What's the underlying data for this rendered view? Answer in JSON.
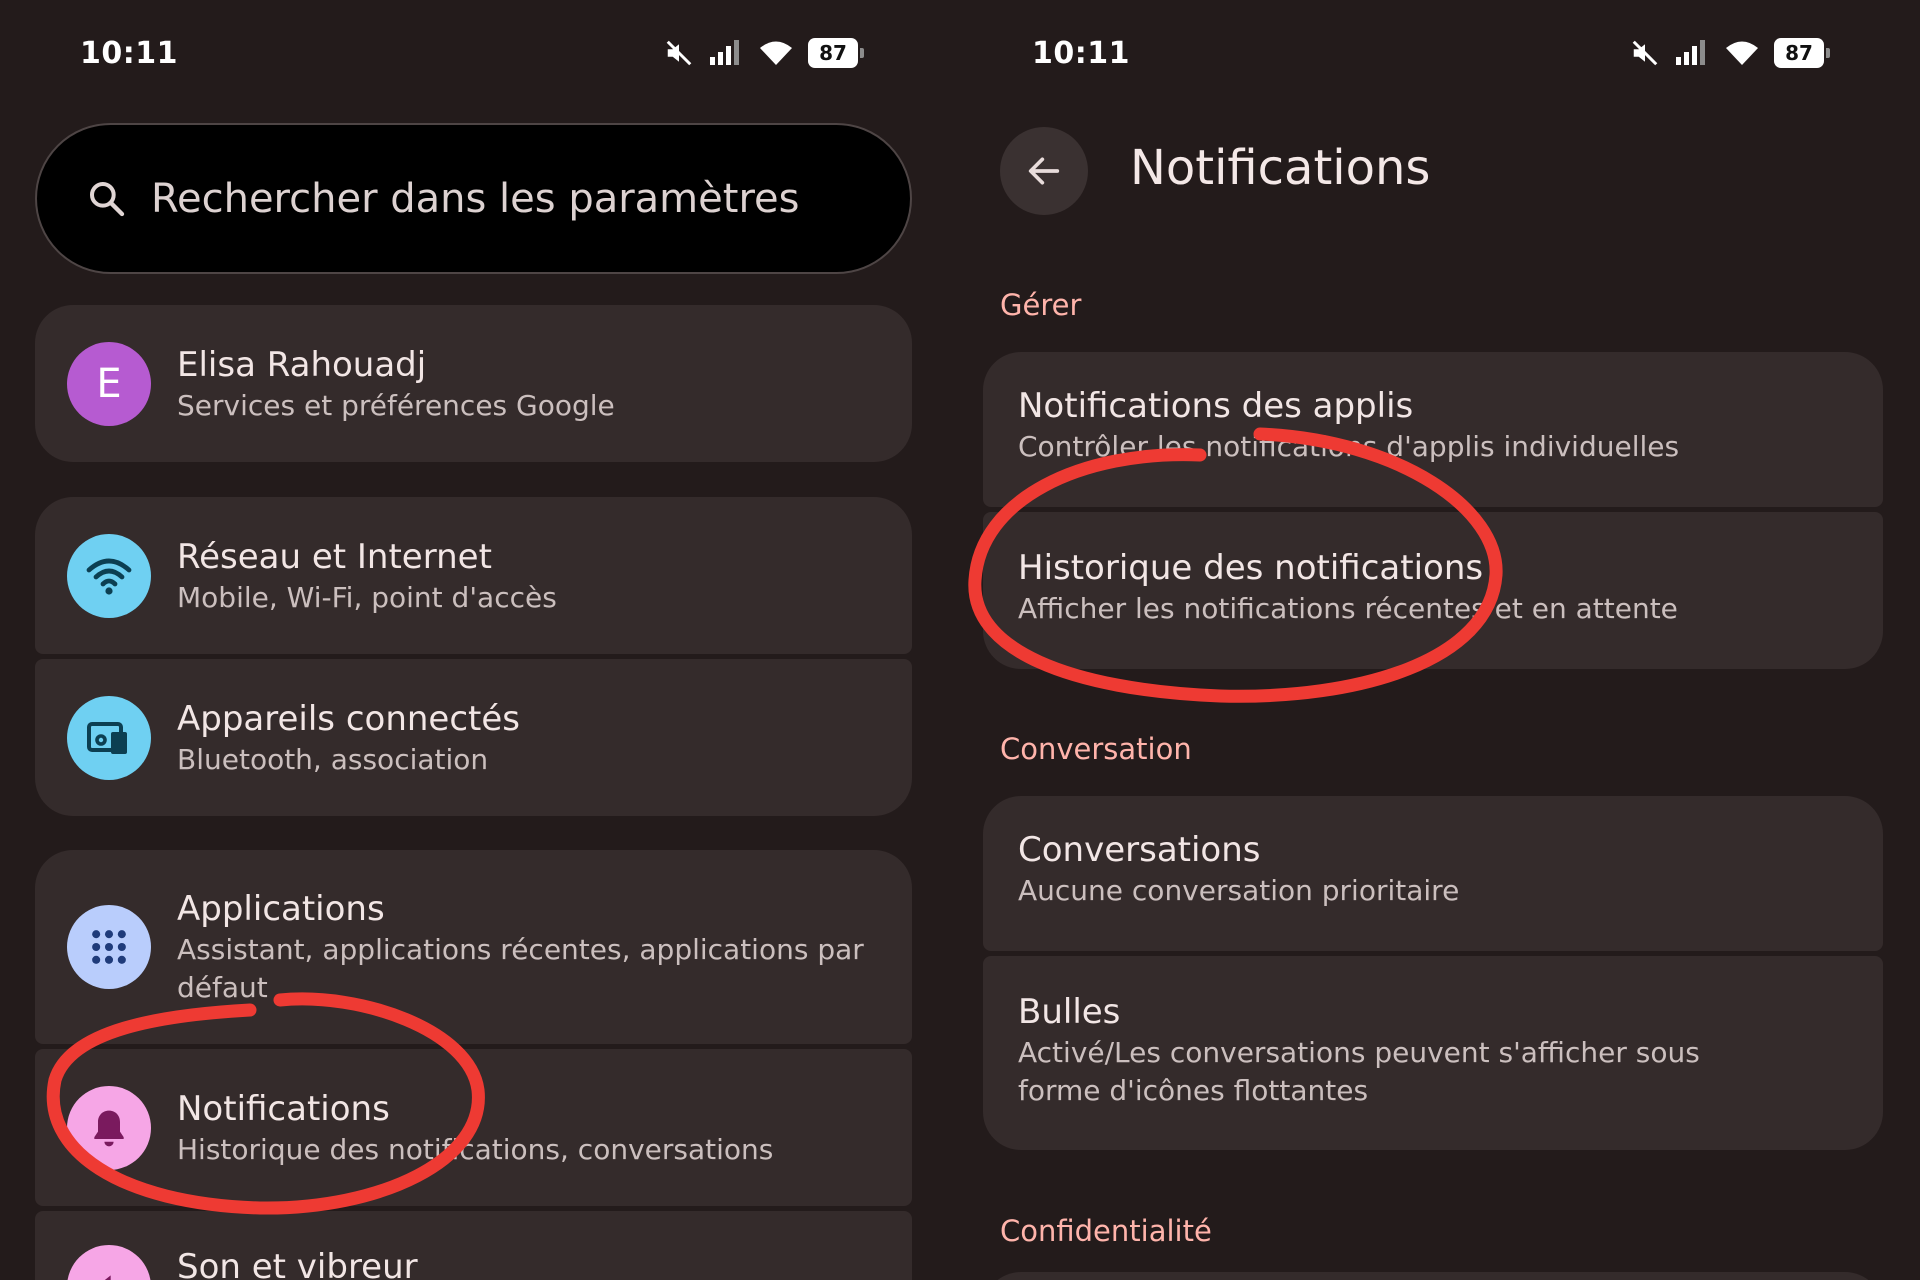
{
  "left_screen": {
    "status": {
      "time": "10:11",
      "battery": "87"
    },
    "search": {
      "placeholder": "Rechercher dans les paramètres"
    },
    "account": {
      "initial": "E",
      "name": "Elisa Rahouadj",
      "subtitle": "Services et préférences Google",
      "avatar_color": "#b65bd1"
    },
    "items": [
      {
        "title": "Réseau et Internet",
        "subtitle": "Mobile, Wi-Fi, point d'accès",
        "icon": "wifi-icon",
        "color": "#6fd0f2"
      },
      {
        "title": "Appareils connectés",
        "subtitle": "Bluetooth, association",
        "icon": "connected-devices-icon",
        "color": "#6fd0f2"
      },
      {
        "title": "Applications",
        "subtitle": "Assistant, applications récentes, applications par",
        "subtitle2": "défaut",
        "icon": "apps-grid-icon",
        "color": "#b9cdfc"
      },
      {
        "title": "Notifications",
        "subtitle": "Historique des notifications, conversations",
        "icon": "bell-icon",
        "color": "#f6a6e6"
      },
      {
        "title": "Son et vibreur",
        "icon": "sound-icon",
        "color": "#f6a6e6"
      }
    ]
  },
  "right_screen": {
    "status": {
      "time": "10:11",
      "battery": "87"
    },
    "title": "Notifications",
    "sections": {
      "manage": "Gérer",
      "conversation": "Conversation",
      "privacy": "Confidentialité"
    },
    "manage_items": [
      {
        "title": "Notifications des applis",
        "subtitle": "Contrôler les notifications d'applis individuelles"
      },
      {
        "title": "Historique des notifications",
        "subtitle": "Afficher les notifications récentes et en attente"
      }
    ],
    "conversation_items": [
      {
        "title": "Conversations",
        "subtitle": "Aucune conversation prioritaire"
      },
      {
        "title": "Bulles",
        "subtitle": "Activé/Les conversations peuvent s'afficher sous",
        "subtitle2": "forme d'icônes flottantes"
      }
    ]
  },
  "colors": {
    "background": "#231b1b",
    "card": "#342b2b",
    "accent": "#ffb4ab",
    "annotation": "#ee3a33"
  }
}
